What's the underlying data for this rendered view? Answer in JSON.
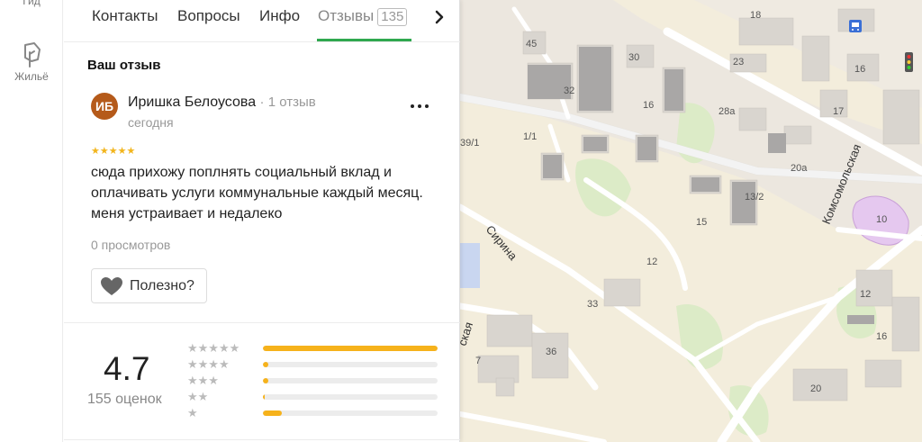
{
  "rail": {
    "top_label": "Гид",
    "housing_label": "Жильё"
  },
  "tabs": [
    {
      "label": "Контакты"
    },
    {
      "label": "Вопросы"
    },
    {
      "label": "Инфо"
    },
    {
      "label": "Отзывы",
      "count": "135"
    }
  ],
  "review_section": {
    "title": "Ваш отзыв",
    "avatar_initials": "ИБ",
    "author_name": "Иришка Белоусова",
    "author_meta": "· 1 отзыв",
    "date": "сегодня",
    "stars": "★★★★★",
    "text": "сюда прихожу поплнять социальный вклад и оплачивать услуги коммунальные каждый месяц. меня устраивает и недалеко",
    "views": "0 просмотров",
    "useful_label": "Полезно?"
  },
  "rating": {
    "value": "4.7",
    "count_label": "155 оценок",
    "distribution": [
      {
        "stars": "★★★★★",
        "fraction": 1.0
      },
      {
        "stars": "★★★★",
        "fraction": 0.03
      },
      {
        "stars": "★★★",
        "fraction": 0.03
      },
      {
        "stars": "★★",
        "fraction": 0.01
      },
      {
        "stars": "★",
        "fraction": 0.11
      }
    ]
  },
  "map": {
    "street_labels": [
      "Сирина",
      "Комсомольская",
      "ская"
    ],
    "house_numbers": [
      "18",
      "45",
      "30",
      "23",
      "16",
      "32",
      "16",
      "17",
      "28а",
      "1/1",
      "39/1",
      "20а",
      "13/2",
      "10",
      "15",
      "12",
      "12",
      "33",
      "36",
      "16",
      "7",
      "20"
    ]
  },
  "colors": {
    "accent": "#2fa84f",
    "star": "#f6b21b",
    "avatar": "#b55a1a"
  }
}
